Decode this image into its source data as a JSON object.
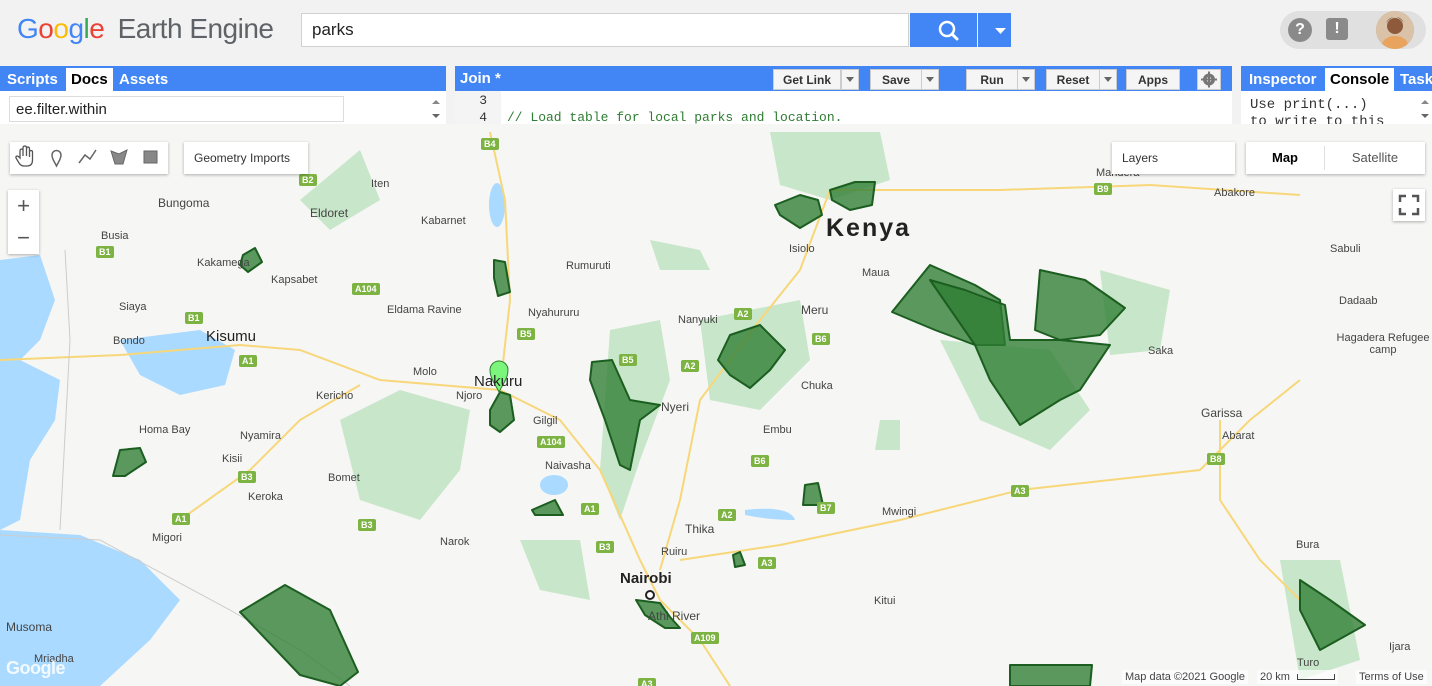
{
  "app": {
    "logo_google": "Google",
    "logo_product": "Earth Engine",
    "search_value": "parks"
  },
  "left_panel": {
    "tabs": [
      "Scripts",
      "Docs",
      "Assets"
    ],
    "active_tab": "Docs",
    "filter_value": "ee.filter.within"
  },
  "editor": {
    "title": "Join *",
    "buttons": {
      "get_link": "Get Link",
      "save": "Save",
      "run": "Run",
      "reset": "Reset",
      "apps": "Apps"
    },
    "lines": [
      {
        "num": "3",
        "code": ""
      },
      {
        "num": "4",
        "code": "// Load table for local parks and location."
      }
    ]
  },
  "right_panel": {
    "tabs": [
      "Inspector",
      "Console",
      "Task"
    ],
    "active_tab": "Console",
    "console_text_1": "Use print(...)",
    "console_text_2": "to write to this"
  },
  "map": {
    "geometry_imports": "Geometry Imports",
    "layers": "Layers",
    "map_type_buttons": [
      "Map",
      "Satellite"
    ],
    "active_map_type": "Map",
    "zoom_in": "+",
    "zoom_out": "−",
    "country": "Kenya",
    "places": [
      "Bungoma",
      "Eldoret",
      "Iten",
      "Kabarnet",
      "Busia",
      "Kakamega",
      "Kapsabet",
      "Siaya",
      "Kisumu",
      "Bondo",
      "Eldama Ravine",
      "Rumuruti",
      "Nyahururu",
      "Nanyuki",
      "Isiolo",
      "Maua",
      "Meru",
      "Molo",
      "Nakuru",
      "Njoro",
      "Kericho",
      "Homa Bay",
      "Nyamira",
      "Kisii",
      "Keroka",
      "Bomet",
      "Gilgil",
      "Naivasha",
      "Nyeri",
      "Embu",
      "Chuka",
      "Migori",
      "Narok",
      "Thika",
      "Ruiru",
      "Nairobi",
      "Athi River",
      "Kitui",
      "Mwingi",
      "Musoma",
      "Mriadha",
      "Abakore",
      "Sabuli",
      "Dadaab",
      "Hagadera Refugee camp",
      "Saka",
      "Garissa",
      "Abarat",
      "Bura",
      "Turo",
      "Ijara",
      "Mandera"
    ],
    "road_labels": [
      "B4",
      "B2",
      "B1",
      "A104",
      "B5",
      "A2",
      "B6",
      "B1",
      "A1",
      "B5",
      "A2",
      "A104",
      "B3",
      "B6",
      "B7",
      "A3",
      "B8",
      "A1",
      "B3",
      "A2",
      "B3",
      "A3",
      "A109",
      "B9",
      "A1",
      "A3"
    ],
    "footer": {
      "attribution": "Map data ©2021 Google",
      "scale": "20 km",
      "terms": "Terms of Use",
      "google": "Google"
    }
  },
  "colors": {
    "accent": "#4285f4",
    "park_fill": "#2e7d32",
    "park_stroke": "#1b5e20",
    "forest": "#c8e6c9",
    "water": "#aadaff",
    "marker": "#7cf57c"
  },
  "icons": [
    "search-icon",
    "dropdown-icon",
    "help-icon",
    "feedback-icon",
    "gear-icon",
    "pan-hand-icon",
    "point-marker-icon",
    "line-draw-icon",
    "polygon-draw-icon",
    "rectangle-draw-icon",
    "fullscreen-icon",
    "map-pin-icon"
  ]
}
